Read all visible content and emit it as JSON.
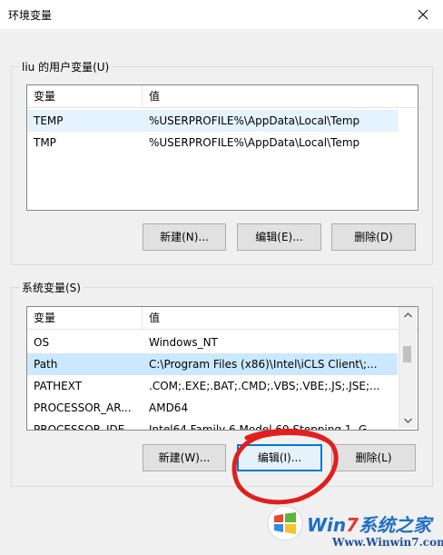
{
  "window": {
    "title": "环境变量",
    "close_icon": "close-icon"
  },
  "user_vars": {
    "legend": "liu 的用户变量(U)",
    "columns": [
      "变量",
      "值"
    ],
    "rows": [
      {
        "name": "TEMP",
        "value": "%USERPROFILE%\\AppData\\Local\\Temp"
      },
      {
        "name": "TMP",
        "value": "%USERPROFILE%\\AppData\\Local\\Temp"
      }
    ],
    "buttons": {
      "new": "新建(N)...",
      "edit": "编辑(E)...",
      "delete": "删除(D)"
    }
  },
  "system_vars": {
    "legend": "系统变量(S)",
    "columns": [
      "变量",
      "值"
    ],
    "rows": [
      {
        "name": "OS",
        "value": "Windows_NT"
      },
      {
        "name": "Path",
        "value": "C:\\Program Files (x86)\\Intel\\iCLS Client\\;..."
      },
      {
        "name": "PATHEXT",
        "value": ".COM;.EXE;.BAT;.CMD;.VBS;.VBE;.JS;.JSE;..."
      },
      {
        "name": "PROCESSOR_AR...",
        "value": "AMD64"
      },
      {
        "name": "PROCESSOR_IDE...",
        "value": "Intel64 Family 6 Model 69 Stepping 1, G..."
      }
    ],
    "selected_row": "Path",
    "buttons": {
      "new": "新建(W)...",
      "edit": "编辑(I)...",
      "delete": "删除(L)"
    }
  },
  "watermark": {
    "brand_prefix": "Win",
    "brand_digit": "7",
    "brand_suffix": "系统之家",
    "url": "Www.Winwin7.com"
  },
  "colors": {
    "selection": "#cce8ff",
    "hover_row": "#e5f3ff",
    "annotation": "#e0201e",
    "focus": "#0078d7"
  }
}
